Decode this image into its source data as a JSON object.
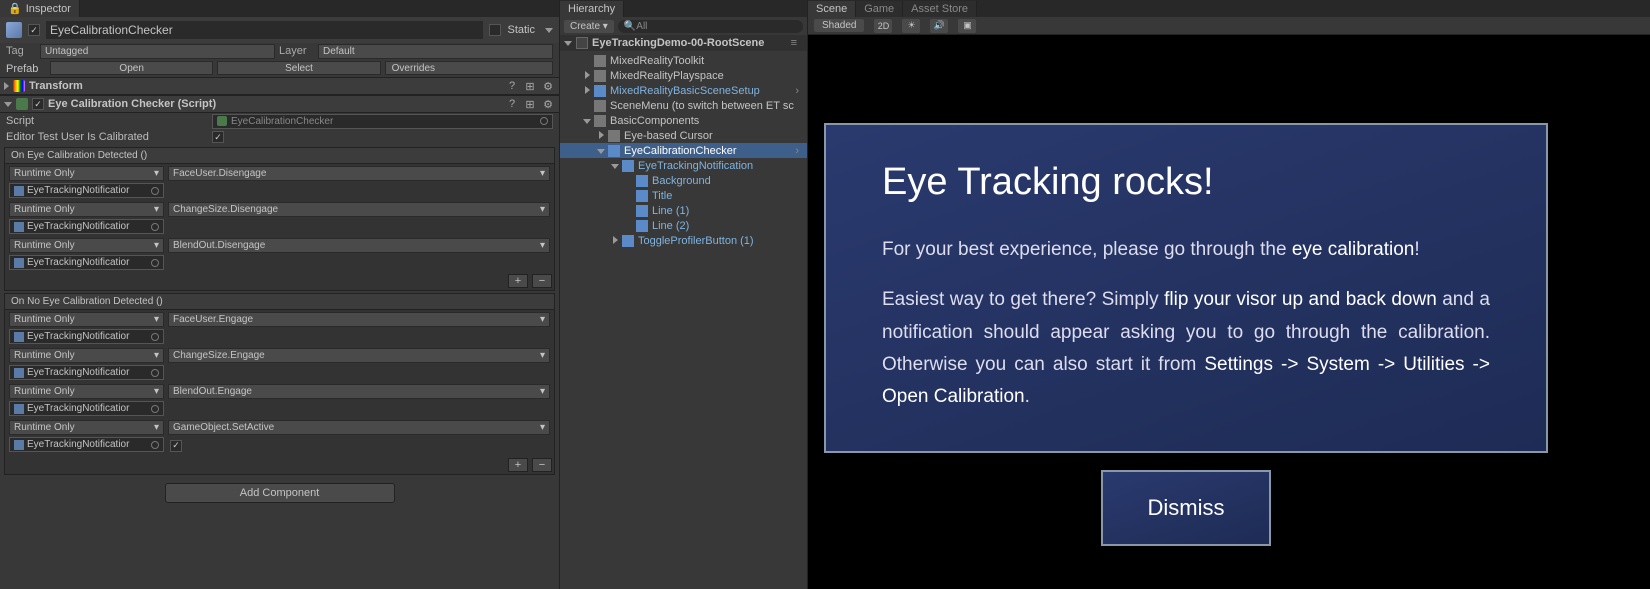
{
  "inspector": {
    "tab": "Inspector",
    "go_name": "EyeCalibrationChecker",
    "static_label": "Static",
    "tag_label": "Tag",
    "tag_value": "Untagged",
    "layer_label": "Layer",
    "layer_value": "Default",
    "prefab_label": "Prefab",
    "open": "Open",
    "select": "Select",
    "overrides": "Overrides",
    "transform": "Transform",
    "script_comp": "Eye Calibration Checker (Script)",
    "script_label": "Script",
    "script_value": "EyeCalibrationChecker",
    "editor_test": "Editor Test User Is Calibrated",
    "on_detected": "On Eye Calibration Detected ()",
    "on_no_detected": "On No Eye Calibration Detected ()",
    "runtime_only": "Runtime Only",
    "target": "EyeTrackingNotificatior",
    "funcs_a": [
      "FaceUser.Disengage",
      "ChangeSize.Disengage",
      "BlendOut.Disengage"
    ],
    "funcs_b": [
      "FaceUser.Engage",
      "ChangeSize.Engage",
      "BlendOut.Engage",
      "GameObject.SetActive"
    ],
    "add_component": "Add Component"
  },
  "hierarchy": {
    "tab": "Hierarchy",
    "create": "Create",
    "search": "All",
    "scene": "EyeTrackingDemo-00-RootScene",
    "items": [
      {
        "d": 1,
        "t": "MixedRealityToolkit",
        "a": "",
        "sel": false,
        "bl": false
      },
      {
        "d": 1,
        "t": "MixedRealityPlayspace",
        "a": "r",
        "sel": false,
        "bl": false
      },
      {
        "d": 1,
        "t": "MixedRealityBasicSceneSetup",
        "a": "r",
        "sel": false,
        "bl": true,
        "more": true
      },
      {
        "d": 1,
        "t": "SceneMenu (to switch between ET sc",
        "a": "",
        "sel": false,
        "bl": false
      },
      {
        "d": 1,
        "t": "BasicComponents",
        "a": "d",
        "sel": false,
        "bl": false
      },
      {
        "d": 2,
        "t": "Eye-based Cursor",
        "a": "r",
        "sel": false,
        "bl": false
      },
      {
        "d": 2,
        "t": "EyeCalibrationChecker",
        "a": "d",
        "sel": true,
        "bl": true,
        "more": true
      },
      {
        "d": 3,
        "t": "EyeTrackingNotification",
        "a": "d",
        "sel": false,
        "bl": true
      },
      {
        "d": 4,
        "t": "Background",
        "a": "",
        "sel": false,
        "bl": true
      },
      {
        "d": 4,
        "t": "Title",
        "a": "",
        "sel": false,
        "bl": true
      },
      {
        "d": 4,
        "t": "Line (1)",
        "a": "",
        "sel": false,
        "bl": true
      },
      {
        "d": 4,
        "t": "Line (2)",
        "a": "",
        "sel": false,
        "bl": true
      },
      {
        "d": 3,
        "t": "ToggleProfilerButton (1)",
        "a": "r",
        "sel": false,
        "bl": true
      }
    ]
  },
  "scene": {
    "tabs": [
      "Scene",
      "Game",
      "Asset Store"
    ],
    "shading": "Shaded",
    "twod": "2D",
    "notif_title": "Eye Tracking rocks!",
    "l1a": "For your best experience, please go through the ",
    "l1b": "eye calibration",
    "l1c": "!",
    "l2a": "Easiest way to get there? Simply ",
    "l2b": "flip your visor up and back down",
    "l2c": " and a notification should appear asking you to go through the calibration. Otherwise you can also start it from ",
    "l2d": "Settings -> System -> Utilities -> Open Calibration",
    "l2e": ".",
    "dismiss": "Dismiss"
  }
}
